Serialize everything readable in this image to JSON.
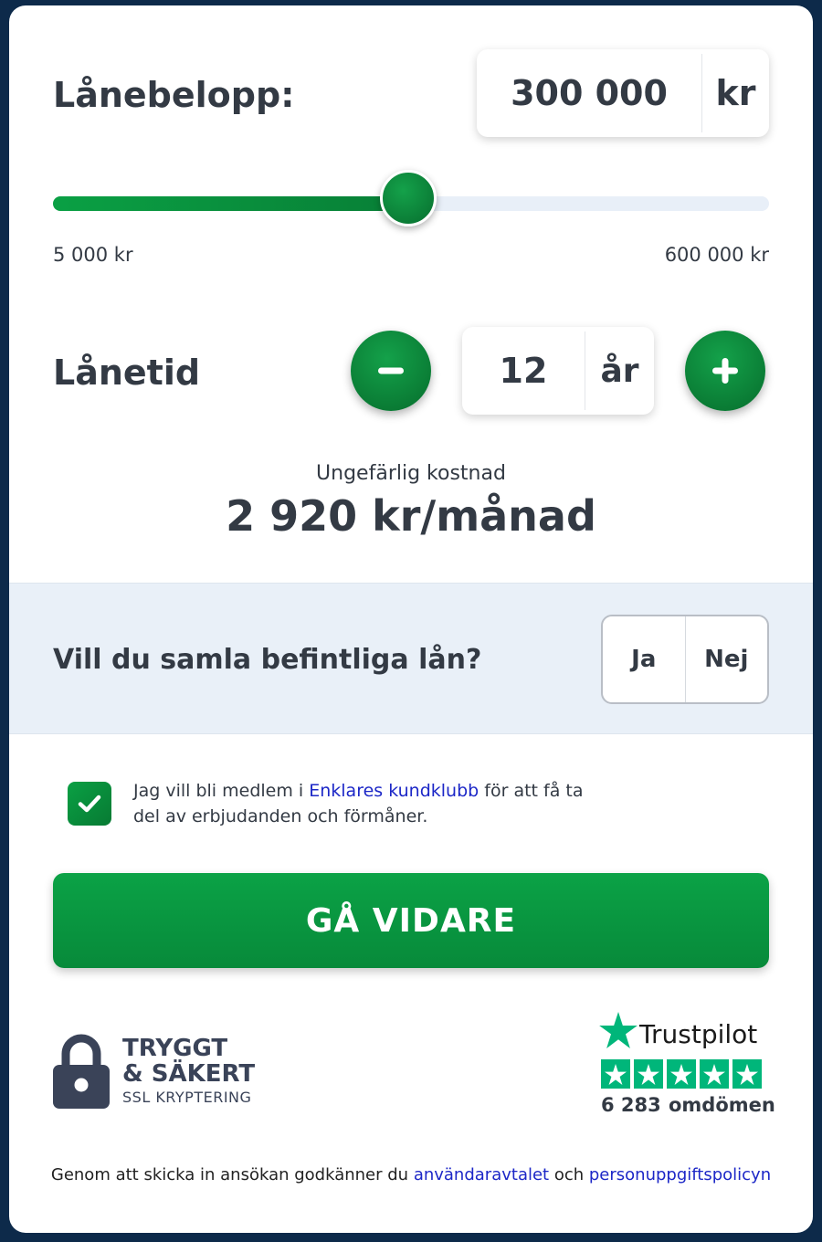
{
  "loan_amount": {
    "label": "Lånebelopp:",
    "value": "300 000",
    "unit": "kr",
    "slider": {
      "min_label": "5 000 kr",
      "max_label": "600 000 kr",
      "fraction": 0.496
    }
  },
  "loan_term": {
    "label": "Lånetid",
    "value": "12",
    "unit": "år",
    "minus_icon": "minus-icon",
    "plus_icon": "plus-icon"
  },
  "cost": {
    "caption": "Ungefärlig kostnad",
    "value": "2 920 kr/månad"
  },
  "consolidate": {
    "question": "Vill du samla befintliga lån?",
    "yes_label": "Ja",
    "no_label": "Nej"
  },
  "consent": {
    "checked": true,
    "text_before": "Jag vill bli medlem i ",
    "link_text": "Enklares kundklubb",
    "text_after": " för att få ta del av erbjudanden och förmåner."
  },
  "cta": {
    "label": "GÅ VIDARE"
  },
  "secure_badge": {
    "line1": "TRYGGT",
    "line2": "& SÄKERT",
    "line3": "SSL KRYPTERING",
    "icon": "lock-icon"
  },
  "trustpilot": {
    "name": "Trustpilot",
    "stars": 5,
    "count": "6 283",
    "reviews_label": "omdömen"
  },
  "footer": {
    "text_before": "Genom att skicka in ansökan godkänner du ",
    "link1": "användaravtalet",
    "text_middle": " och ",
    "link2": "personuppgiftspolicyn"
  },
  "colors": {
    "accent": "#0aa044",
    "link": "#1c27c7",
    "text": "#333a44",
    "background": "#0d2a4a",
    "band": "#e9f0f8",
    "trustpilot": "#00b67a"
  }
}
